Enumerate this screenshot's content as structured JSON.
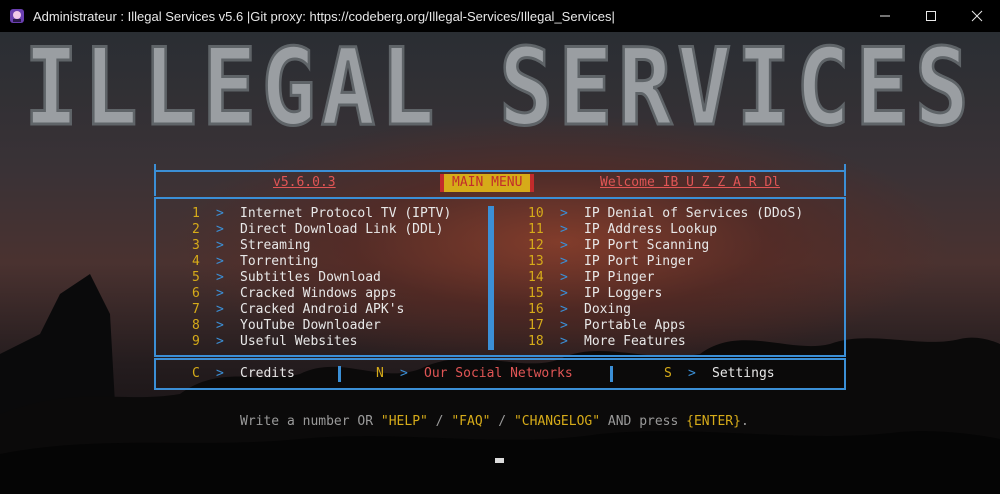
{
  "window": {
    "title": "Administrateur :  Illegal Services v5.6  |Git proxy: https://codeberg.org/Illegal-Services/Illegal_Services|",
    "icon": "app-icon",
    "controls": [
      "minimize-icon",
      "maximize-icon",
      "close-icon"
    ]
  },
  "banner": {
    "text": "ILLEGAL SERVICES"
  },
  "header": {
    "version": "v5.6.0.3",
    "main_menu": "MAIN MENU",
    "welcome": "Welcome IB U Z Z A R Dl"
  },
  "menu_left": [
    {
      "num": "1",
      "label": "Internet Protocol TV (IPTV)"
    },
    {
      "num": "2",
      "label": "Direct Download Link (DDL)"
    },
    {
      "num": "3",
      "label": "Streaming"
    },
    {
      "num": "4",
      "label": "Torrenting"
    },
    {
      "num": "5",
      "label": "Subtitles Download"
    },
    {
      "num": "6",
      "label": "Cracked Windows apps"
    },
    {
      "num": "7",
      "label": "Cracked Android APK's"
    },
    {
      "num": "8",
      "label": "YouTube Downloader"
    },
    {
      "num": "9",
      "label": "Useful Websites"
    }
  ],
  "menu_right": [
    {
      "num": "10",
      "label": "IP Denial of Services (DDoS)"
    },
    {
      "num": "11",
      "label": "IP Address Lookup"
    },
    {
      "num": "12",
      "label": "IP Port Scanning"
    },
    {
      "num": "13",
      "label": "IP Port Pinger"
    },
    {
      "num": "14",
      "label": "IP Pinger"
    },
    {
      "num": "15",
      "label": "IP Loggers"
    },
    {
      "num": "16",
      "label": "Doxing"
    },
    {
      "num": "17",
      "label": "Portable Apps"
    },
    {
      "num": "18",
      "label": "More Features"
    }
  ],
  "bottom": {
    "credits_key": "C",
    "credits_label": "Credits",
    "social_key": "N",
    "social_label": "Our Social Networks",
    "settings_key": "S",
    "settings_label": "Settings"
  },
  "arrow": ">",
  "prompt": {
    "p1": "Write a number OR ",
    "help": "\"HELP\"",
    "s1": " / ",
    "faq": "\"FAQ\"",
    "s2": " / ",
    "changelog": "\"CHANGELOG\"",
    "p2": " AND press ",
    "enter": "{ENTER}",
    "p3": "."
  },
  "colors": {
    "accent": "#3b8fd6",
    "number": "#d6ab19",
    "highlight": "#e05555",
    "text": "#e8e8e8"
  }
}
